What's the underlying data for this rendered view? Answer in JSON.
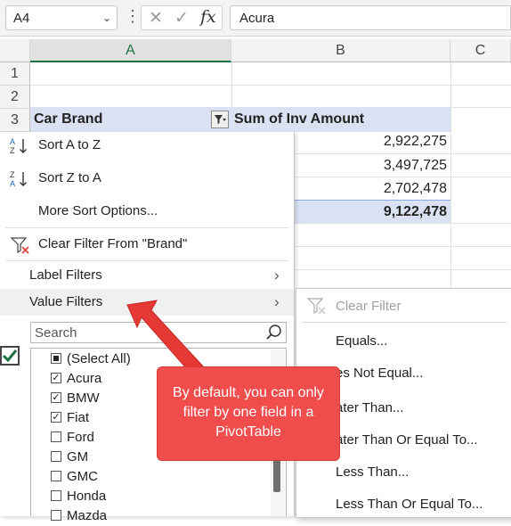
{
  "formula_bar": {
    "name_box": "A4",
    "fx_label": "fx",
    "cancel_glyph": "✕",
    "enter_glyph": "✓",
    "content": "Acura"
  },
  "columns": [
    "A",
    "B",
    "C"
  ],
  "rows": [
    "1",
    "2",
    "3"
  ],
  "pivot": {
    "header_a": "Car Brand",
    "header_b": "Sum of Inv Amount",
    "values": [
      "2,922,275",
      "3,497,725",
      "2,702,478"
    ],
    "total": "9,122,478"
  },
  "menu": {
    "sort_az": "Sort A to Z",
    "sort_za": "Sort Z to A",
    "more_sort": "More Sort Options...",
    "clear_filter": "Clear Filter From \"Brand\"",
    "label_filters": "Label Filters",
    "value_filters": "Value Filters",
    "search_placeholder": "Search",
    "items": [
      {
        "label": "(Select All)",
        "state": "partial"
      },
      {
        "label": "Acura",
        "state": "checked"
      },
      {
        "label": "BMW",
        "state": "checked"
      },
      {
        "label": "Fiat",
        "state": "checked"
      },
      {
        "label": "Ford",
        "state": "unchecked"
      },
      {
        "label": "GM",
        "state": "unchecked"
      },
      {
        "label": "GMC",
        "state": "unchecked"
      },
      {
        "label": "Honda",
        "state": "unchecked"
      },
      {
        "label": "Mazda",
        "state": "unchecked"
      }
    ]
  },
  "submenu": {
    "clear_filter": "Clear Filter",
    "items": [
      "Equals...",
      "es Not Equal...",
      "ater Than...",
      "ater Than Or Equal To...",
      "Less Than...",
      "Less Than Or Equal To..."
    ]
  },
  "callout": {
    "text": "By default, you can only filter by one field in a PivotTable"
  },
  "colors": {
    "accent_green": "#1e7145",
    "pivot_header": "#d9e1f2",
    "callout_red": "#f14d4d",
    "arrow_red": "#e53935"
  }
}
